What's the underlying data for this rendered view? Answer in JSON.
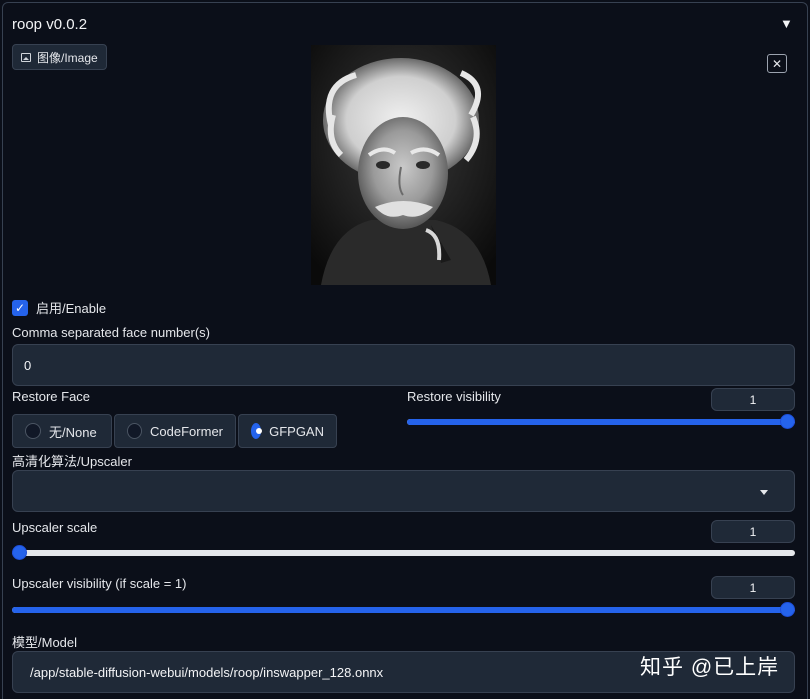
{
  "panel": {
    "title": "roop v0.0.2",
    "collapse_icon": "triangle-down-icon"
  },
  "image": {
    "tab_label": "图像/Image",
    "tab_icon": "image-icon",
    "close_label": "✕"
  },
  "enable": {
    "label": "启用/Enable",
    "checked": true
  },
  "face_numbers": {
    "label": "Comma separated face number(s)",
    "value": "0"
  },
  "restore_face": {
    "label": "Restore Face",
    "options": [
      "无/None",
      "CodeFormer",
      "GFPGAN"
    ],
    "selected": "GFPGAN"
  },
  "restore_visibility": {
    "label": "Restore visibility",
    "value": "1",
    "level": 1.0
  },
  "upscaler": {
    "label": "高清化算法/Upscaler",
    "value": ""
  },
  "upscaler_scale": {
    "label": "Upscaler scale",
    "value": "1",
    "level": 0.0
  },
  "upscaler_visibility": {
    "label": "Upscaler visibility (if scale = 1)",
    "value": "1",
    "level": 1.0
  },
  "model": {
    "label": "模型/Model",
    "value": "/app/stable-diffusion-webui/models/roop/inswapper_128.onnx"
  },
  "watermark": "知乎 @已上岸",
  "colors": {
    "background": "#0b0f19",
    "field": "#1f2937",
    "accent": "#2563eb",
    "border": "#374151"
  }
}
